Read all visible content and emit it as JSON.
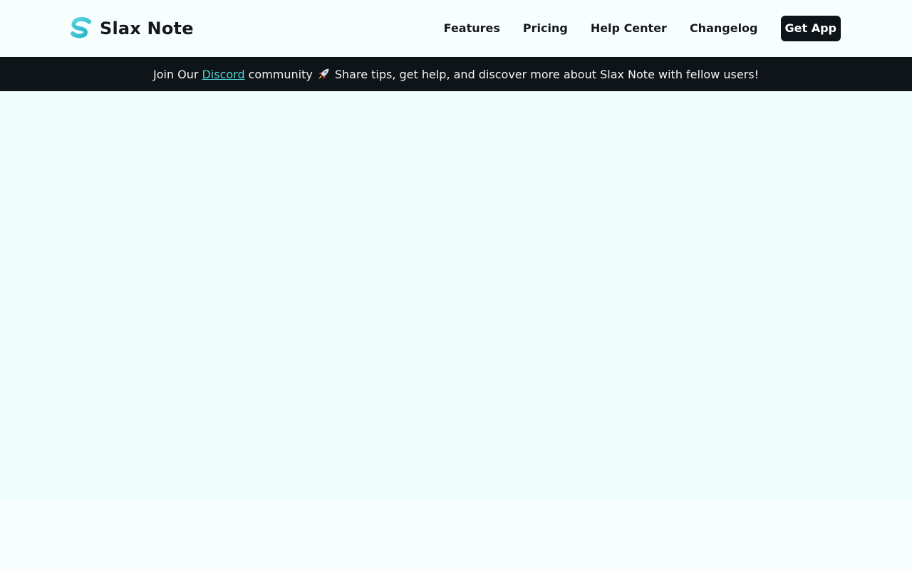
{
  "brand": {
    "name": "Slax Note",
    "logo_icon": "s-logo-icon",
    "colors": {
      "logo_top": "#4fd1e0",
      "logo_bottom": "#2bb9c9"
    }
  },
  "nav": {
    "items": [
      {
        "label": "Features"
      },
      {
        "label": "Pricing"
      },
      {
        "label": "Help Center"
      },
      {
        "label": "Changelog"
      }
    ],
    "cta_label": "Get App"
  },
  "banner": {
    "prefix": "Join Our",
    "link_text": "Discord",
    "middle": "community",
    "emoji_icon": "rocket-icon",
    "suffix": "Share tips, get help, and discover more about Slax Note with fellow users!"
  },
  "colors": {
    "page_bg": "#f8fefe",
    "hero_bg": "#f0fdfd",
    "banner_bg": "#0f1419",
    "link_accent": "#4fd1d1",
    "text_dark": "#15191e"
  }
}
